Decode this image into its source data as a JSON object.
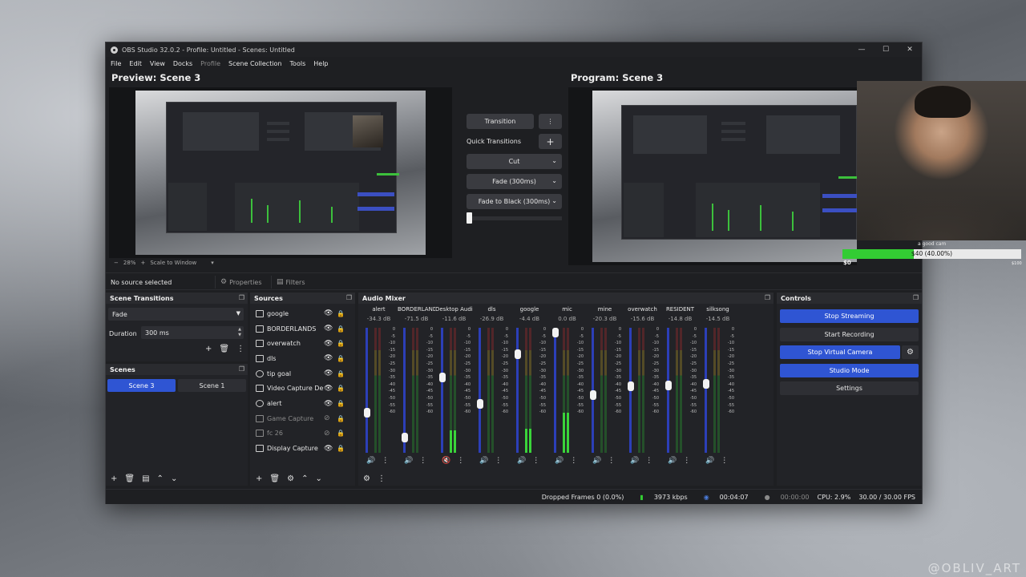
{
  "window": {
    "title": "OBS Studio 32.0.2 - Profile: Untitled - Scenes: Untitled"
  },
  "menu": [
    "File",
    "Edit",
    "View",
    "Docks",
    "Profile",
    "Scene Collection",
    "Tools",
    "Help"
  ],
  "preview": {
    "title": "Preview: Scene 3",
    "zoom": "28%",
    "scale_mode": "Scale to Window"
  },
  "program": {
    "title": "Program: Scene 3"
  },
  "transitions_panel": {
    "transition_label": "Transition",
    "quick_label": "Quick Transitions",
    "items": [
      "Cut",
      "Fade (300ms)",
      "Fade to Black (300ms)"
    ]
  },
  "source_bar": {
    "status": "No source selected",
    "properties": "Properties",
    "filters": "Filters"
  },
  "scene_transitions": {
    "title": "Scene Transitions",
    "selected": "Fade",
    "duration_label": "Duration",
    "duration_value": "300 ms"
  },
  "scenes": {
    "title": "Scenes",
    "items": [
      {
        "label": "Scene 3",
        "active": true
      },
      {
        "label": "Scene 1",
        "active": false
      }
    ]
  },
  "sources": {
    "title": "Sources",
    "items": [
      {
        "label": "google",
        "visible": true
      },
      {
        "label": "BORDERLANDS",
        "visible": true
      },
      {
        "label": "overwatch",
        "visible": true
      },
      {
        "label": "dls",
        "visible": true
      },
      {
        "label": "tip goal",
        "visible": true
      },
      {
        "label": "Video Capture De",
        "visible": true
      },
      {
        "label": "alert",
        "visible": true
      },
      {
        "label": "Game Capture",
        "visible": false
      },
      {
        "label": "fc 26",
        "visible": false
      },
      {
        "label": "Display Capture",
        "visible": true
      }
    ]
  },
  "audio_mixer": {
    "title": "Audio Mixer",
    "scale": [
      "0",
      "-5",
      "-10",
      "-15",
      "-20",
      "-25",
      "-30",
      "-35",
      "-40",
      "-45",
      "-50",
      "-55",
      "-60"
    ],
    "channels": [
      {
        "name": "alert",
        "db": "-34.3 dB",
        "fader": 0.32,
        "level": 0.0,
        "muted": false
      },
      {
        "name": "BORDERLANDS",
        "db": "-71.5 dB",
        "fader": 0.12,
        "level": 0.0,
        "muted": false
      },
      {
        "name": "Desktop Audio",
        "db": "-11.6 dB",
        "fader": 0.6,
        "level": 0.18,
        "muted": true
      },
      {
        "name": "dls",
        "db": "-26.9 dB",
        "fader": 0.39,
        "level": 0.0,
        "muted": false
      },
      {
        "name": "google",
        "db": "-4.4 dB",
        "fader": 0.79,
        "level": 0.19,
        "muted": false
      },
      {
        "name": "mic",
        "db": "0.0 dB",
        "fader": 0.96,
        "level": 0.32,
        "muted": false
      },
      {
        "name": "mine",
        "db": "-20.3 dB",
        "fader": 0.46,
        "level": 0.0,
        "muted": false
      },
      {
        "name": "overwatch",
        "db": "-15.6 dB",
        "fader": 0.53,
        "level": 0.0,
        "muted": false
      },
      {
        "name": "RESIDENT",
        "db": "-14.8 dB",
        "fader": 0.54,
        "level": 0.0,
        "muted": false
      },
      {
        "name": "silksong",
        "db": "-14.5 dB",
        "fader": 0.55,
        "level": 0.0,
        "muted": false
      }
    ]
  },
  "controls": {
    "title": "Controls",
    "buttons": [
      "Stop Streaming",
      "Start Recording",
      "Stop Virtual Camera",
      "Studio Mode",
      "Settings"
    ]
  },
  "statusbar": {
    "dropped": "Dropped Frames 0 (0.0%)",
    "kbps": "3973 kbps",
    "stream_time": "00:04:07",
    "rec_time": "00:00:00",
    "cpu": "CPU: 2.9%",
    "fps": "30.00 / 30.00 FPS"
  },
  "overlay": {
    "cam_label": "a good cam",
    "goal_text": "$40 (40.00%)",
    "goal_progress": 0.4,
    "goal_min": "$0",
    "goal_max": "$100"
  },
  "watermark": "@OBLIV_ART",
  "colors": {
    "accent_blue": "#2f55d3",
    "meter_green": "#2da12d",
    "goal_green": "#33cc33"
  }
}
